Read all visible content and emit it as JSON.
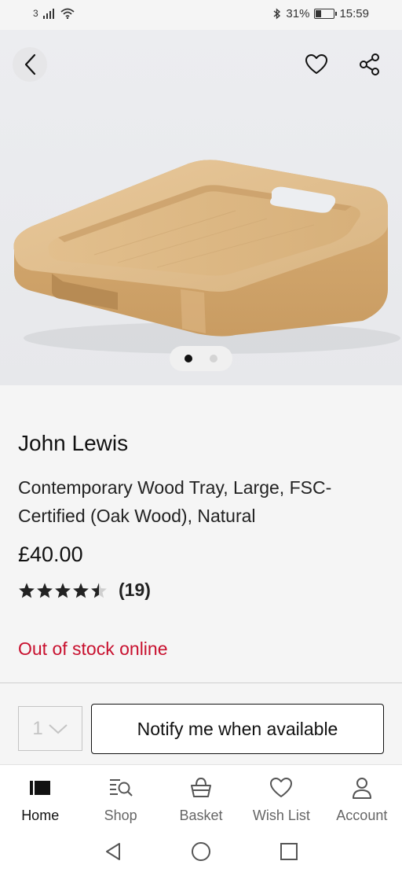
{
  "status_bar": {
    "carrier": "3",
    "bluetooth": "bluetooth-icon",
    "battery_percent": "31%",
    "battery_level": 0.31,
    "time": "15:59"
  },
  "hero": {
    "back_icon": "chevron-left-icon",
    "favourite_icon": "heart-icon",
    "share_icon": "share-icon",
    "image_count": 2,
    "active_image": 1
  },
  "product": {
    "brand": "John Lewis",
    "title": "Contemporary Wood Tray, Large, FSC-Certified (Oak Wood), Natural",
    "price": "£40.00",
    "rating": 4.5,
    "review_count": "(19)",
    "stock_status": "Out of stock online",
    "stock_color": "#c8102e"
  },
  "purchase": {
    "quantity": "1",
    "notify_label": "Notify me when available"
  },
  "tabs": [
    {
      "label": "Home",
      "icon": "home-icon",
      "active": true
    },
    {
      "label": "Shop",
      "icon": "search-list-icon",
      "active": false
    },
    {
      "label": "Basket",
      "icon": "basket-icon",
      "active": false
    },
    {
      "label": "Wish List",
      "icon": "heart-icon",
      "active": false
    },
    {
      "label": "Account",
      "icon": "person-icon",
      "active": false
    }
  ],
  "system_nav": {
    "back": "triangle-back-icon",
    "home": "circle-home-icon",
    "recents": "square-recents-icon"
  }
}
